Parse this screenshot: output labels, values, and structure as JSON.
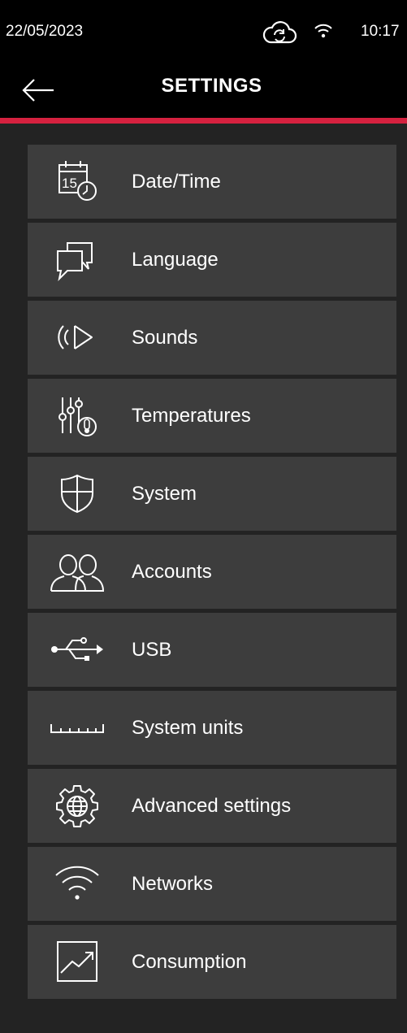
{
  "status": {
    "date": "22/05/2023",
    "time": "10:17",
    "icons": [
      "cloud-sync-icon",
      "wifi-icon"
    ]
  },
  "header": {
    "title": "SETTINGS",
    "back_icon": "arrow-left-icon"
  },
  "colors": {
    "accent": "#d5213f",
    "item_background": "#3d3d3d",
    "page_background": "#232323"
  },
  "menu": {
    "items": [
      {
        "label": "Date/Time",
        "icon": "calendar-clock-icon"
      },
      {
        "label": "Language",
        "icon": "chat-bubbles-icon"
      },
      {
        "label": "Sounds",
        "icon": "speaker-icon"
      },
      {
        "label": "Temperatures",
        "icon": "sliders-thermometer-icon"
      },
      {
        "label": "System",
        "icon": "shield-icon"
      },
      {
        "label": "Accounts",
        "icon": "users-icon"
      },
      {
        "label": "USB",
        "icon": "usb-icon"
      },
      {
        "label": "System units",
        "icon": "ruler-icon"
      },
      {
        "label": "Advanced settings",
        "icon": "gear-globe-icon"
      },
      {
        "label": "Networks",
        "icon": "wifi-icon"
      },
      {
        "label": "Consumption",
        "icon": "chart-trend-icon"
      }
    ]
  }
}
